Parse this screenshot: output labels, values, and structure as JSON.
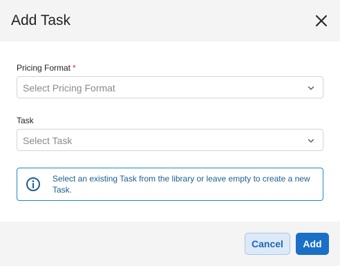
{
  "dialog": {
    "title": "Add Task"
  },
  "fields": {
    "pricing_format": {
      "label": "Pricing Format",
      "required_marker": "*",
      "placeholder": "Select Pricing Format"
    },
    "task": {
      "label": "Task",
      "placeholder": "Select Task"
    }
  },
  "info": {
    "message": "Select an existing Task from the library or leave empty to create a new Task."
  },
  "footer": {
    "cancel_label": "Cancel",
    "add_label": "Add"
  },
  "colors": {
    "primary": "#1b6fc7",
    "info_border": "#1e88c8",
    "required": "#d9342b"
  },
  "icons": {
    "close": "close-icon",
    "chevron": "chevron-down-icon",
    "info": "info-circle-icon"
  }
}
